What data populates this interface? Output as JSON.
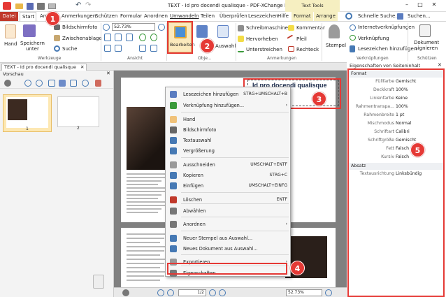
{
  "window": {
    "title": "TEXT - Id pro docendi qualisque - PDF-XChange Editor",
    "context_tab": "Text Tools"
  },
  "menu": [
    "Datei",
    "Start",
    "Ansicht",
    "Anmerkungen",
    "Schützen",
    "Formular",
    "Anordnen",
    "Umwandeln",
    "Teilen",
    "Überprüfen",
    "Lesezeichen",
    "Hilfe",
    "Format",
    "Arrange"
  ],
  "quick_search": {
    "label": "Schnelle Suche...",
    "search_label": "Suchen..."
  },
  "ribbon": {
    "hand": "Hand",
    "save": "Speichern\nunter",
    "screenshot": "Bildschirmfoto",
    "clipboard": "Zwischenablage",
    "search": "Suche",
    "group_tools": "Werkzeuge",
    "zoom": "52.73%",
    "group_view": "Ansicht",
    "edit": "Bearbeiten",
    "group_objects": "Obje...",
    "select": "Auswahl",
    "typewriter": "Schreibmaschine",
    "highlight": "Hervorheben",
    "underline": "Unterstreichen",
    "comment": "Kommentar",
    "arrow": "Pfeil",
    "rectangle": "Rechteck",
    "group_annotations": "Anmerkungen",
    "stamp": "Stempel",
    "internet_links": "Internetverknüpfungen",
    "link": "Verknüpfung",
    "add_bookmark": "Lesezeichen hinzufügen",
    "group_links": "Verknüpfungen",
    "sign": "Dokument\nsignieren",
    "group_protect": "Schützen"
  },
  "doc_tab": "TEXT - Id pro docendi qualisque",
  "thumbnails": {
    "title": "Vorschau",
    "pages": [
      "1",
      "2"
    ]
  },
  "doc": {
    "selected_text": "Id pro docendi qualisque"
  },
  "context_menu": [
    {
      "label": "Lesezeichen hinzufügen",
      "shortcut": "STRG+UMSCHALT+B"
    },
    {
      "label": "Verknüpfung hinzufügen...",
      "shortcut": ""
    },
    {
      "label": "Hand",
      "shortcut": ""
    },
    {
      "label": "Bildschirmfoto",
      "shortcut": ""
    },
    {
      "label": "Textauswahl",
      "shortcut": ""
    },
    {
      "label": "Vergrößerung",
      "shortcut": ""
    },
    {
      "label": "Ausschneiden",
      "shortcut": "UMSCHALT+ENTF"
    },
    {
      "label": "Kopieren",
      "shortcut": "STRG+C"
    },
    {
      "label": "Einfügen",
      "shortcut": "UMSCHALT+EINFG"
    },
    {
      "label": "Löschen",
      "shortcut": "ENTF"
    },
    {
      "label": "Abwählen",
      "shortcut": ""
    },
    {
      "label": "Anordnen",
      "shortcut": ""
    },
    {
      "label": "Neuer Stempel aus Auswahl...",
      "shortcut": ""
    },
    {
      "label": "Neues Dokument aus Auswahl...",
      "shortcut": ""
    },
    {
      "label": "Exportieren",
      "shortcut": ""
    },
    {
      "label": "Eigenschaften...",
      "shortcut": ""
    }
  ],
  "properties": {
    "title": "Eigenschaften von Seiteninhalt",
    "section_format": "Format",
    "rows": [
      {
        "k": "Füllfarbe",
        "v": "Gemischt"
      },
      {
        "k": "Deckkraft",
        "v": "100%"
      },
      {
        "k": "Linienfarbe",
        "v": "Keine"
      },
      {
        "k": "Rahmentranspa...",
        "v": "100%"
      },
      {
        "k": "Rahmenbreite",
        "v": "1 pt"
      },
      {
        "k": "Mischmodus",
        "v": "Normal"
      },
      {
        "k": "Schriftart",
        "v": "Calibri"
      },
      {
        "k": "Schriftgröße",
        "v": "Gemischt"
      },
      {
        "k": "Fett",
        "v": "Falsch"
      },
      {
        "k": "Kursiv",
        "v": "Falsch"
      }
    ],
    "section_paragraph": "Absatz",
    "alignment_k": "Textausrichtung",
    "alignment_v": "Linksbündig"
  },
  "statusbar": {
    "page": "1/2",
    "zoom": "52.73%"
  },
  "callouts": [
    "1",
    "2",
    "3",
    "4",
    "5"
  ]
}
